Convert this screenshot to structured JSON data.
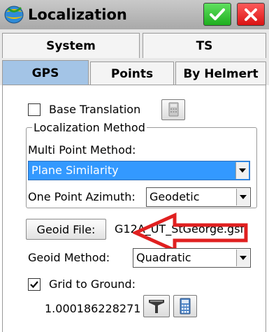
{
  "window": {
    "title": "Localization",
    "ok_icon": "checkmark-icon",
    "close_icon": "close-x-icon",
    "colors": {
      "ok": "#22b022",
      "close": "#e01e1e",
      "active_tab": "#a3c4e6",
      "selection": "#3399ff"
    }
  },
  "tabs": {
    "row1": [
      "System",
      "TS"
    ],
    "row2": [
      "GPS",
      "Points",
      "By Helmert"
    ],
    "active": "GPS"
  },
  "gps": {
    "base_translation": {
      "label": "Base Translation",
      "checked": false,
      "button_icon": "calculator-icon"
    },
    "localization_method": {
      "legend": "Localization Method",
      "multi_point_label": "Multi Point Method:",
      "multi_point_value": "Plane Similarity",
      "one_point_label": "One Point Azimuth:",
      "one_point_value": "Geodetic"
    },
    "geoid": {
      "button_label": "Geoid File:",
      "file_value": "G12A_UT_StGeorge.gsf",
      "method_label": "Geoid Method:",
      "method_value": "Quadratic"
    },
    "grid_to_ground": {
      "label": "Grid to Ground:",
      "checked": true,
      "value": "1.000186228271",
      "filter_icon": "funnel-icon",
      "calc_icon": "calculator-icon"
    }
  },
  "annotation": {
    "arrow_icon": "red-arrow-icon",
    "color": "#e02020"
  }
}
